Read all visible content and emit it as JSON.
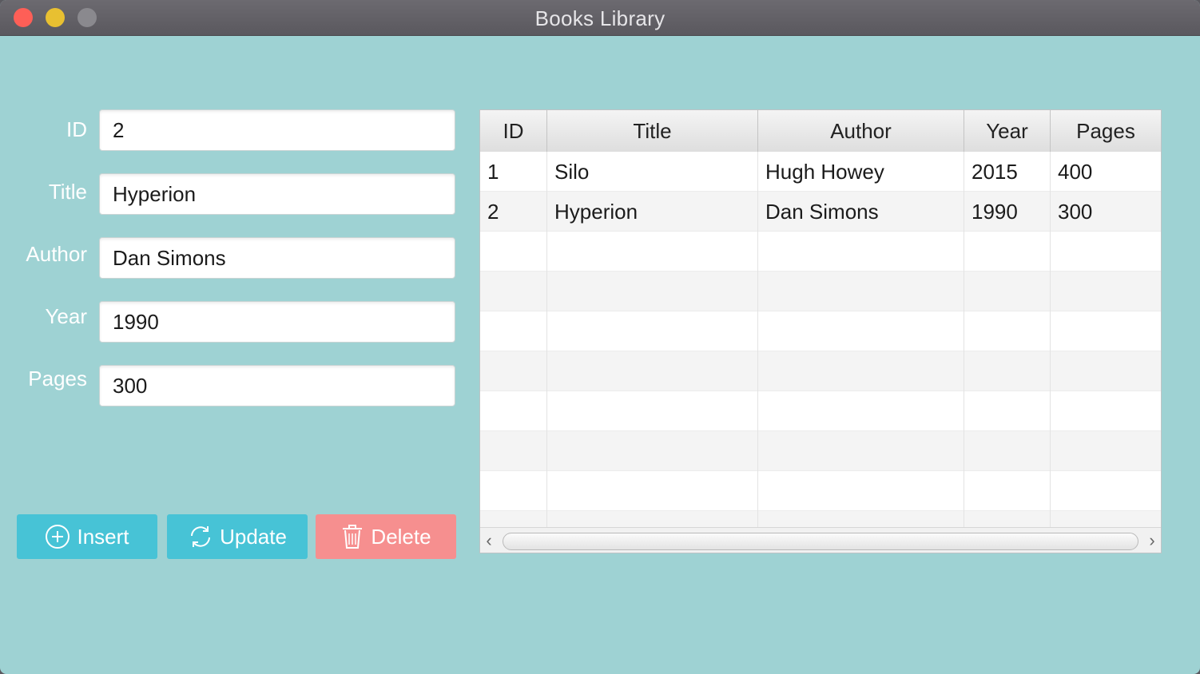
{
  "window": {
    "title": "Books Library"
  },
  "form": {
    "id": {
      "label": "ID",
      "value": "2"
    },
    "title": {
      "label": "Title",
      "value": "Hyperion"
    },
    "author": {
      "label": "Author",
      "value": "Dan Simons"
    },
    "year": {
      "label": "Year",
      "value": "1990"
    },
    "pages": {
      "label": "Pages",
      "value": "300"
    }
  },
  "buttons": {
    "insert": {
      "label": "Insert",
      "icon": "plus-circle-icon",
      "color": "#47c3d6"
    },
    "update": {
      "label": "Update",
      "icon": "refresh-icon",
      "color": "#47c3d6"
    },
    "delete": {
      "label": "Delete",
      "icon": "trash-icon",
      "color": "#f68f8f"
    }
  },
  "table": {
    "columns": [
      "ID",
      "Title",
      "Author",
      "Year",
      "Pages"
    ],
    "rows": [
      [
        "1",
        "Silo",
        "Hugh Howey",
        "2015",
        "400"
      ],
      [
        "2",
        "Hyperion",
        "Dan Simons",
        "1990",
        "300"
      ]
    ]
  },
  "colors": {
    "background": "#9ed2d3",
    "accent": "#47c3d6",
    "danger": "#f68f8f"
  }
}
